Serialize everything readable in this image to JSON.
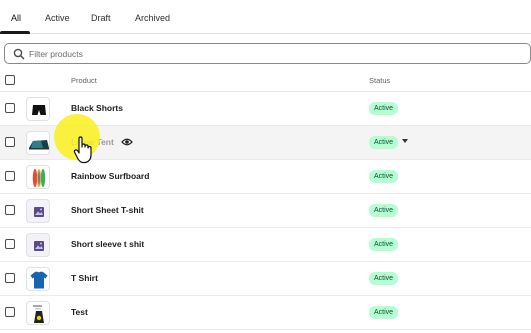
{
  "tabs": [
    {
      "label": "All",
      "active": true
    },
    {
      "label": "Active",
      "active": false
    },
    {
      "label": "Draft",
      "active": false
    },
    {
      "label": "Archived",
      "active": false
    }
  ],
  "search": {
    "placeholder": "Filter products",
    "value": ""
  },
  "table": {
    "columns": [
      "Product",
      "Status"
    ],
    "rows": [
      {
        "name": "Black Shorts",
        "status": "Active",
        "thumb": "black-shorts"
      },
      {
        "name": "Large Tent",
        "status": "Active",
        "thumb": "tent",
        "hovered": true
      },
      {
        "name": "Rainbow Surfboard",
        "status": "Active",
        "thumb": "surfboard"
      },
      {
        "name": "Short Sheet T-shit",
        "status": "Active",
        "thumb": "image-placeholder"
      },
      {
        "name": "Short sleeve t shit",
        "status": "Active",
        "thumb": "image-placeholder"
      },
      {
        "name": "T Shirt",
        "status": "Active",
        "thumb": "tshirt"
      },
      {
        "name": "Test",
        "status": "Active",
        "thumb": "test-product"
      }
    ]
  },
  "colors": {
    "badge_bg": "#b4fed2",
    "badge_text": "#0c5132",
    "cursor_highlight": "#faf01e"
  }
}
